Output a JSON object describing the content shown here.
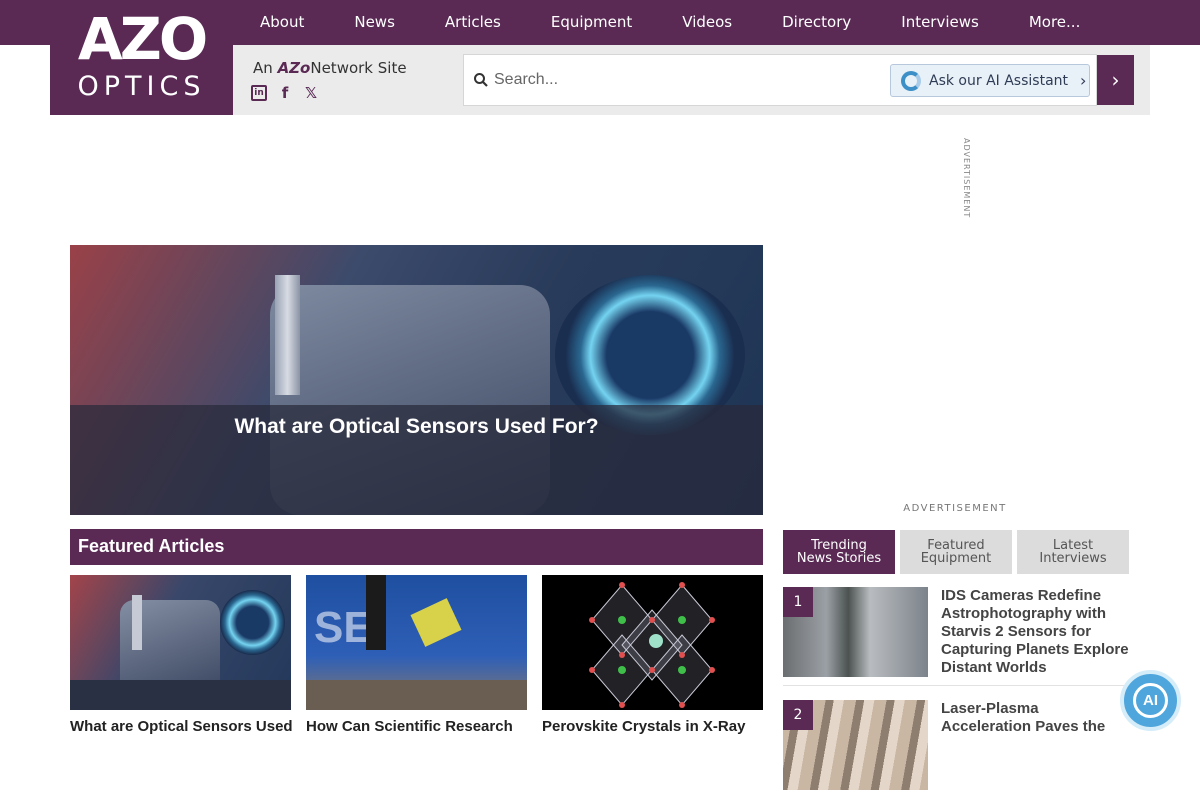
{
  "nav": {
    "items": [
      "About",
      "News",
      "Articles",
      "Equipment",
      "Videos",
      "Directory",
      "Interviews",
      "More..."
    ]
  },
  "logo": {
    "line1": "AZO",
    "line2": "OPTICS"
  },
  "network": {
    "prefix": "An",
    "brand": "AZo",
    "suffix": "Network Site"
  },
  "social": [
    "linkedin-icon",
    "facebook-icon",
    "x-icon"
  ],
  "search": {
    "placeholder": "Search...",
    "ai_label": "Ask our AI Assistant"
  },
  "advert": {
    "vertical": "ADVERTISEMENT",
    "horizontal": "ADVERTISEMENT"
  },
  "hero": {
    "title": "What are Optical Sensors Used For?"
  },
  "featured": {
    "heading": "Featured Articles",
    "articles": [
      {
        "title": "What are Optical Sensors Used"
      },
      {
        "title": "How Can Scientific Research"
      },
      {
        "title": "Perovskite Crystals in X-Ray"
      }
    ]
  },
  "tabs": [
    {
      "line1": "Trending",
      "line2": "News Stories",
      "active": true
    },
    {
      "line1": "Featured",
      "line2": "Equipment",
      "active": false
    },
    {
      "line1": "Latest",
      "line2": "Interviews",
      "active": false
    }
  ],
  "trending": [
    {
      "rank": "1",
      "title": "IDS Cameras Redefine Astrophotography with Starvis 2 Sensors for Capturing Planets Explore Distant Worlds"
    },
    {
      "rank": "2",
      "title": "Laser-Plasma Acceleration Paves the"
    }
  ],
  "chat": {
    "label": "AI"
  },
  "colors": {
    "brand": "#5a2a55",
    "chat": "#4fa6dc",
    "ai_button": "#e8f0f8"
  }
}
